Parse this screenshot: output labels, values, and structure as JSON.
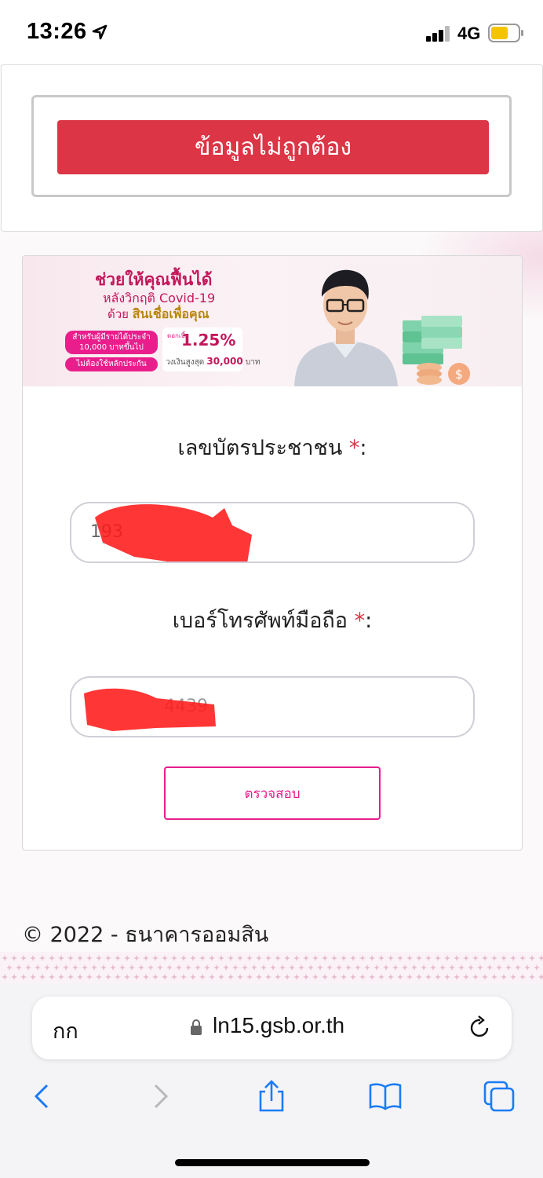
{
  "status_bar": {
    "time": "13:26",
    "network": "4G",
    "battery_color": "#f5c400"
  },
  "error": {
    "message": "ข้อมูลไม่ถูกต้อง"
  },
  "banner": {
    "title": "ช่วยให้คุณฟื้นได้",
    "subtitle": "หลังวิกฤติ Covid-19",
    "with_prefix": "ด้วย",
    "product": "สินเชื่อเพื่อคุณ",
    "pill_income": "สำหรับผู้มีรายได้ประจำ 10,000 บาทขึ้นไป",
    "pill_no_collateral": "ไม่ต้องใช้หลักประกัน",
    "interest_label": "ดอกเบี้ย",
    "interest_rate": "1.25%",
    "limit_prefix": "วงเงินสูงสุด",
    "limit_amount": "30,000",
    "limit_unit": "บาท"
  },
  "form": {
    "id_label": "เลขบัตรประชาชน",
    "id_value": "193",
    "phone_label": "เบอร์โทรศัพท์มือถือ",
    "phone_value": "4439",
    "required_mark": "*",
    "label_suffix": ":",
    "check_button": "ตรวจสอบ"
  },
  "footer": {
    "copyright": "© 2022 - ธนาคารออมสิน"
  },
  "browser": {
    "text_size_label": "กก",
    "url": "ln15.gsb.or.th",
    "accent": "#1a7cf5"
  }
}
